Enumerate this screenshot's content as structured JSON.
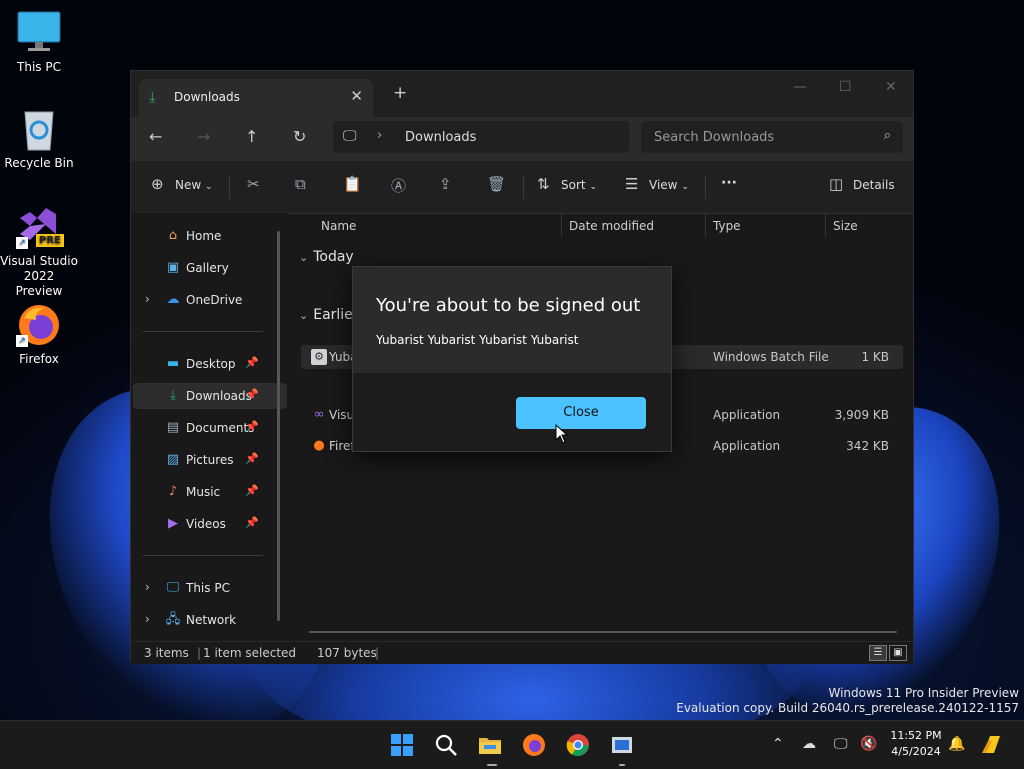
{
  "desktop": {
    "icons": [
      {
        "label": "This PC"
      },
      {
        "label": "Recycle Bin"
      },
      {
        "label": "Visual Studio 2022 Preview"
      },
      {
        "label": "Firefox"
      }
    ],
    "vs_badge": "PRE"
  },
  "window": {
    "tab_title": "Downloads",
    "new_tab": "+",
    "address": {
      "crumb": "Downloads"
    },
    "search_placeholder": "Search Downloads",
    "toolbar": {
      "new_label": "New",
      "sort_label": "Sort",
      "view_label": "View",
      "more_label": "···",
      "details_label": "Details"
    },
    "sidebar": {
      "items": [
        {
          "label": "Home"
        },
        {
          "label": "Gallery"
        },
        {
          "label": "OneDrive"
        },
        {
          "label": "Desktop"
        },
        {
          "label": "Downloads"
        },
        {
          "label": "Documents"
        },
        {
          "label": "Pictures"
        },
        {
          "label": "Music"
        },
        {
          "label": "Videos"
        },
        {
          "label": "This PC"
        },
        {
          "label": "Network"
        }
      ]
    },
    "columns": {
      "name": "Name",
      "date": "Date modified",
      "type": "Type",
      "size": "Size"
    },
    "groups": {
      "today": "Today",
      "earlier": "Earlier"
    },
    "files": [
      {
        "name": "Yuba",
        "type": "Windows Batch File",
        "size": "1 KB"
      },
      {
        "name": "Visua",
        "type": "Application",
        "size": "3,909 KB"
      },
      {
        "name": "Firef",
        "type": "Application",
        "size": "342 KB"
      }
    ],
    "status": {
      "count": "3 items",
      "selected": "1 item selected",
      "bytes": "107 bytes"
    }
  },
  "dialog": {
    "title": "You're about to be signed out",
    "message": "Yubarist Yubarist Yubarist Yubarist",
    "button": "Close"
  },
  "watermark": {
    "line1": "Windows 11 Pro Insider Preview",
    "line2": "Evaluation copy. Build 26040.rs_prerelease.240122-1157"
  },
  "taskbar": {
    "time": "11:52 PM",
    "date": "4/5/2024"
  },
  "colors": {
    "accent": "#4cc2ff",
    "folder_green": "#2ea86b"
  }
}
